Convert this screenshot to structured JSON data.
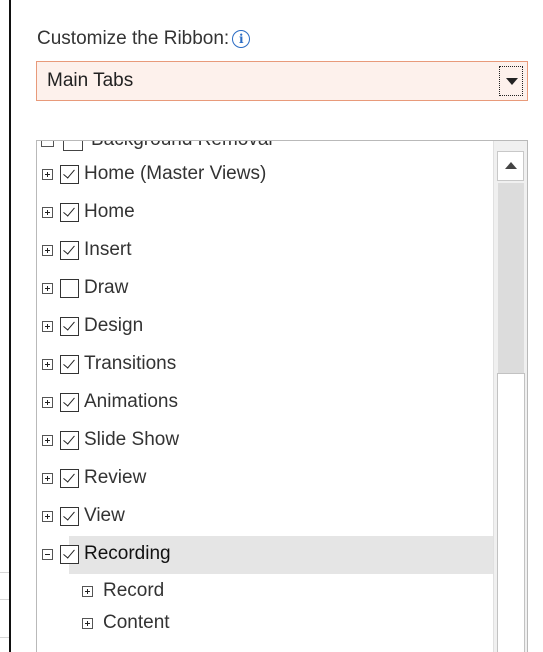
{
  "header": {
    "title": "Customize the Ribbon:",
    "info_icon": "info-icon",
    "info_glyph": "i"
  },
  "dropdown": {
    "selected": "Main Tabs",
    "icon": "chevron-down-icon"
  },
  "tree": {
    "cutoff_label": "Background Removal",
    "items": [
      {
        "label": "Home (Master Views)",
        "checked": true,
        "expanded": false
      },
      {
        "label": "Home",
        "checked": true,
        "expanded": false
      },
      {
        "label": "Insert",
        "checked": true,
        "expanded": false
      },
      {
        "label": "Draw",
        "checked": false,
        "expanded": false
      },
      {
        "label": "Design",
        "checked": true,
        "expanded": false
      },
      {
        "label": "Transitions",
        "checked": true,
        "expanded": false
      },
      {
        "label": "Animations",
        "checked": true,
        "expanded": false
      },
      {
        "label": "Slide Show",
        "checked": true,
        "expanded": false
      },
      {
        "label": "Review",
        "checked": true,
        "expanded": false
      },
      {
        "label": "View",
        "checked": true,
        "expanded": false
      },
      {
        "label": "Recording",
        "checked": true,
        "expanded": true,
        "selected": true
      }
    ],
    "subitems": [
      {
        "label": "Record"
      },
      {
        "label": "Content"
      }
    ]
  },
  "colors": {
    "dropdown_border": "#e89a7a",
    "dropdown_bg": "#fdf1ec",
    "selected_row": "#e5e5e5",
    "info_blue": "#2b6cc4"
  },
  "scrollbar": {
    "position_fraction": 0.45
  }
}
